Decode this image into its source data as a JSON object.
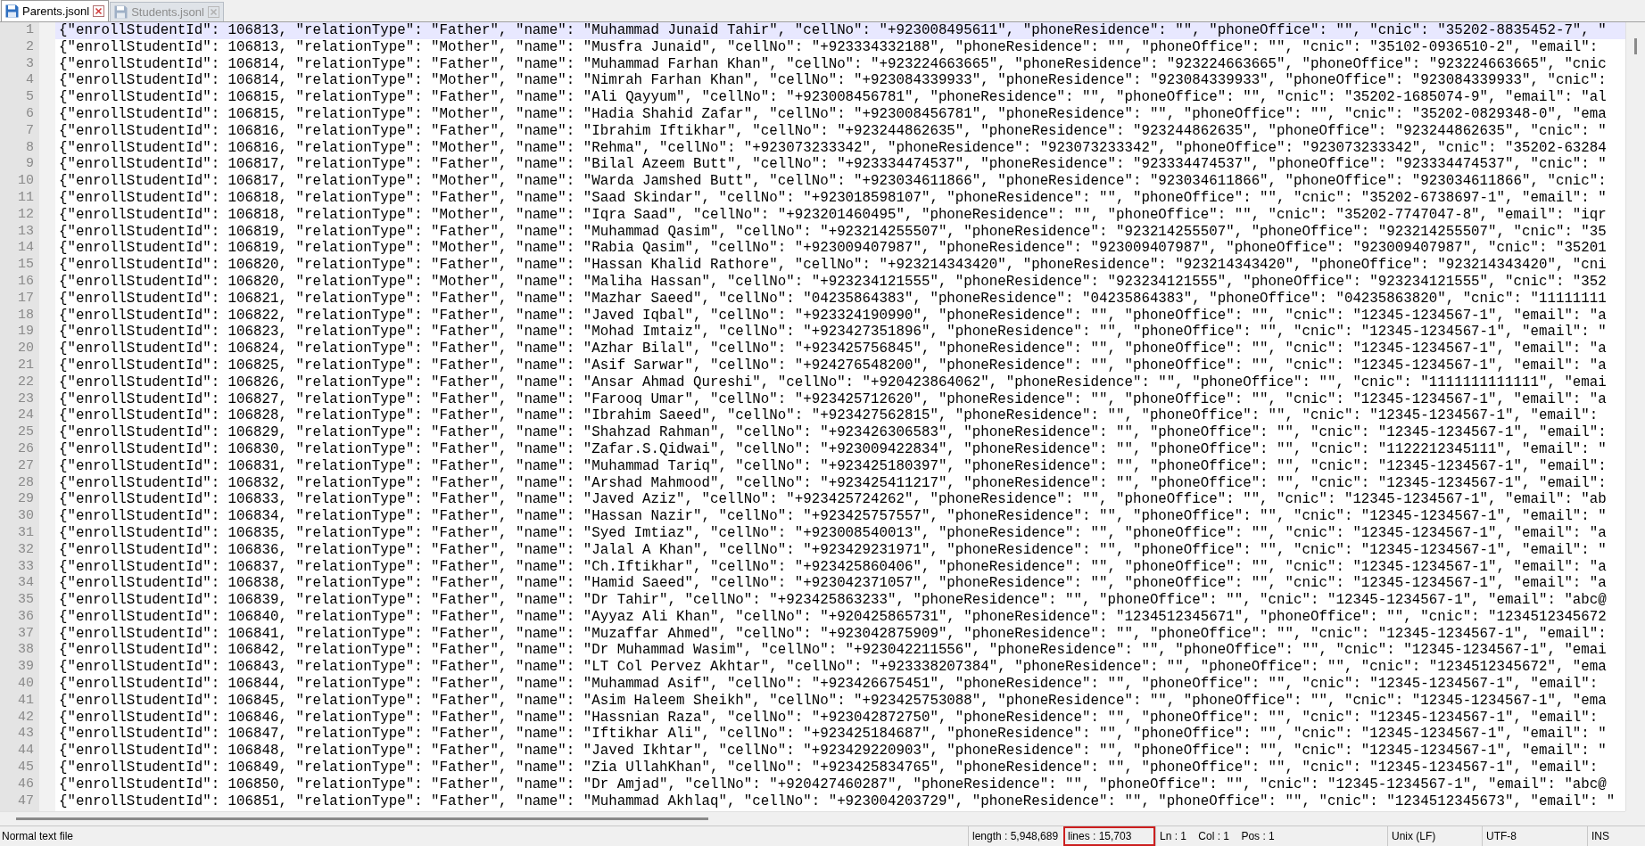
{
  "tabs": [
    {
      "label": "Parents.jsonl",
      "selected": true
    },
    {
      "label": "Students.jsonl",
      "selected": false
    }
  ],
  "editor": {
    "lines": [
      {
        "number": "1",
        "current": true,
        "text": "{\"enrollStudentId\": 106813, \"relationType\": \"Father\", \"name\": \"Muhammad Junaid Tahir\", \"cellNo\": \"+923008495611\", \"phoneResidence\": \"\", \"phoneOffice\": \"\", \"cnic\": \"35202-8835452-7\", \""
      },
      {
        "number": "2",
        "current": false,
        "text": "{\"enrollStudentId\": 106813, \"relationType\": \"Mother\", \"name\": \"Musfra Junaid\", \"cellNo\": \"+923334332188\", \"phoneResidence\": \"\", \"phoneOffice\": \"\", \"cnic\": \"35102-0936510-2\", \"email\":"
      },
      {
        "number": "3",
        "current": false,
        "text": "{\"enrollStudentId\": 106814, \"relationType\": \"Father\", \"name\": \"Muhammad Farhan Khan\", \"cellNo\": \"+923224663665\", \"phoneResidence\": \"923224663665\", \"phoneOffice\": \"923224663665\", \"cnic"
      },
      {
        "number": "4",
        "current": false,
        "text": "{\"enrollStudentId\": 106814, \"relationType\": \"Mother\", \"name\": \"Nimrah Farhan Khan\", \"cellNo\": \"+923084339933\", \"phoneResidence\": \"923084339933\", \"phoneOffice\": \"923084339933\", \"cnic\":"
      },
      {
        "number": "5",
        "current": false,
        "text": "{\"enrollStudentId\": 106815, \"relationType\": \"Father\", \"name\": \"Ali Qayyum\", \"cellNo\": \"+923008456781\", \"phoneResidence\": \"\", \"phoneOffice\": \"\", \"cnic\": \"35202-1685074-9\", \"email\": \"al"
      },
      {
        "number": "6",
        "current": false,
        "text": "{\"enrollStudentId\": 106815, \"relationType\": \"Mother\", \"name\": \"Hadia Shahid Zafar\", \"cellNo\": \"+923008456781\", \"phoneResidence\": \"\", \"phoneOffice\": \"\", \"cnic\": \"35202-0829348-0\", \"ema"
      },
      {
        "number": "7",
        "current": false,
        "text": "{\"enrollStudentId\": 106816, \"relationType\": \"Father\", \"name\": \"Ibrahim Iftikhar\", \"cellNo\": \"+923244862635\", \"phoneResidence\": \"923244862635\", \"phoneOffice\": \"923244862635\", \"cnic\": \""
      },
      {
        "number": "8",
        "current": false,
        "text": "{\"enrollStudentId\": 106816, \"relationType\": \"Mother\", \"name\": \"Rehma\", \"cellNo\": \"+923073233342\", \"phoneResidence\": \"923073233342\", \"phoneOffice\": \"923073233342\", \"cnic\": \"35202-63284"
      },
      {
        "number": "9",
        "current": false,
        "text": "{\"enrollStudentId\": 106817, \"relationType\": \"Father\", \"name\": \"Bilal Azeem Butt\", \"cellNo\": \"+923334474537\", \"phoneResidence\": \"923334474537\", \"phoneOffice\": \"923334474537\", \"cnic\": \""
      },
      {
        "number": "10",
        "current": false,
        "text": "{\"enrollStudentId\": 106817, \"relationType\": \"Mother\", \"name\": \"Warda Jamshed Butt\", \"cellNo\": \"+923034611866\", \"phoneResidence\": \"923034611866\", \"phoneOffice\": \"923034611866\", \"cnic\":"
      },
      {
        "number": "11",
        "current": false,
        "text": "{\"enrollStudentId\": 106818, \"relationType\": \"Father\", \"name\": \"Saad Skindar\", \"cellNo\": \"+923018598107\", \"phoneResidence\": \"\", \"phoneOffice\": \"\", \"cnic\": \"35202-6738697-1\", \"email\": \""
      },
      {
        "number": "12",
        "current": false,
        "text": "{\"enrollStudentId\": 106818, \"relationType\": \"Mother\", \"name\": \"Iqra Saad\", \"cellNo\": \"+923201460495\", \"phoneResidence\": \"\", \"phoneOffice\": \"\", \"cnic\": \"35202-7747047-8\", \"email\": \"iqr"
      },
      {
        "number": "13",
        "current": false,
        "text": "{\"enrollStudentId\": 106819, \"relationType\": \"Father\", \"name\": \"Muhammad Qasim\", \"cellNo\": \"+923214255507\", \"phoneResidence\": \"923214255507\", \"phoneOffice\": \"923214255507\", \"cnic\": \"35"
      },
      {
        "number": "14",
        "current": false,
        "text": "{\"enrollStudentId\": 106819, \"relationType\": \"Mother\", \"name\": \"Rabia Qasim\", \"cellNo\": \"+923009407987\", \"phoneResidence\": \"923009407987\", \"phoneOffice\": \"923009407987\", \"cnic\": \"35201"
      },
      {
        "number": "15",
        "current": false,
        "text": "{\"enrollStudentId\": 106820, \"relationType\": \"Father\", \"name\": \"Hassan Khalid Rathore\", \"cellNo\": \"+923214343420\", \"phoneResidence\": \"923214343420\", \"phoneOffice\": \"923214343420\", \"cni"
      },
      {
        "number": "16",
        "current": false,
        "text": "{\"enrollStudentId\": 106820, \"relationType\": \"Mother\", \"name\": \"Maliha Hassan\", \"cellNo\": \"+923234121555\", \"phoneResidence\": \"923234121555\", \"phoneOffice\": \"923234121555\", \"cnic\": \"352"
      },
      {
        "number": "17",
        "current": false,
        "text": "{\"enrollStudentId\": 106821, \"relationType\": \"Father\", \"name\": \"Mazhar Saeed\", \"cellNo\": \"04235864383\", \"phoneResidence\": \"04235864383\", \"phoneOffice\": \"04235863820\", \"cnic\": \"11111111"
      },
      {
        "number": "18",
        "current": false,
        "text": "{\"enrollStudentId\": 106822, \"relationType\": \"Father\", \"name\": \"Javed Iqbal\", \"cellNo\": \"+923324190990\", \"phoneResidence\": \"\", \"phoneOffice\": \"\", \"cnic\": \"12345-1234567-1\", \"email\": \"a"
      },
      {
        "number": "19",
        "current": false,
        "text": "{\"enrollStudentId\": 106823, \"relationType\": \"Father\", \"name\": \"Mohad Imtaiz\", \"cellNo\": \"+923427351896\", \"phoneResidence\": \"\", \"phoneOffice\": \"\", \"cnic\": \"12345-1234567-1\", \"email\": \""
      },
      {
        "number": "20",
        "current": false,
        "text": "{\"enrollStudentId\": 106824, \"relationType\": \"Father\", \"name\": \"Azhar Bilal\", \"cellNo\": \"+923425756845\", \"phoneResidence\": \"\", \"phoneOffice\": \"\", \"cnic\": \"12345-1234567-1\", \"email\": \"a"
      },
      {
        "number": "21",
        "current": false,
        "text": "{\"enrollStudentId\": 106825, \"relationType\": \"Father\", \"name\": \"Asif Sarwar\", \"cellNo\": \"+924276548200\", \"phoneResidence\": \"\", \"phoneOffice\": \"\", \"cnic\": \"12345-1234567-1\", \"email\": \"a"
      },
      {
        "number": "22",
        "current": false,
        "text": "{\"enrollStudentId\": 106826, \"relationType\": \"Father\", \"name\": \"Ansar Ahmad Qureshi\", \"cellNo\": \"+920423864062\", \"phoneResidence\": \"\", \"phoneOffice\": \"\", \"cnic\": \"1111111111111\", \"emai"
      },
      {
        "number": "23",
        "current": false,
        "text": "{\"enrollStudentId\": 106827, \"relationType\": \"Father\", \"name\": \"Farooq Umar\", \"cellNo\": \"+923425712620\", \"phoneResidence\": \"\", \"phoneOffice\": \"\", \"cnic\": \"12345-1234567-1\", \"email\": \"a"
      },
      {
        "number": "24",
        "current": false,
        "text": "{\"enrollStudentId\": 106828, \"relationType\": \"Father\", \"name\": \"Ibrahim Saeed\", \"cellNo\": \"+923427562815\", \"phoneResidence\": \"\", \"phoneOffice\": \"\", \"cnic\": \"12345-1234567-1\", \"email\":"
      },
      {
        "number": "25",
        "current": false,
        "text": "{\"enrollStudentId\": 106829, \"relationType\": \"Father\", \"name\": \"Shahzad Rahman\", \"cellNo\": \"+923426306583\", \"phoneResidence\": \"\", \"phoneOffice\": \"\", \"cnic\": \"12345-1234567-1\", \"email\":"
      },
      {
        "number": "26",
        "current": false,
        "text": "{\"enrollStudentId\": 106830, \"relationType\": \"Father\", \"name\": \"Zafar.S.Qidwai\", \"cellNo\": \"+923009422834\", \"phoneResidence\": \"\", \"phoneOffice\": \"\", \"cnic\": \"1122212345111\", \"email\": \""
      },
      {
        "number": "27",
        "current": false,
        "text": "{\"enrollStudentId\": 106831, \"relationType\": \"Father\", \"name\": \"Muhammad Tariq\", \"cellNo\": \"+923425180397\", \"phoneResidence\": \"\", \"phoneOffice\": \"\", \"cnic\": \"12345-1234567-1\", \"email\":"
      },
      {
        "number": "28",
        "current": false,
        "text": "{\"enrollStudentId\": 106832, \"relationType\": \"Father\", \"name\": \"Arshad Mahmood\", \"cellNo\": \"+923425411217\", \"phoneResidence\": \"\", \"phoneOffice\": \"\", \"cnic\": \"12345-1234567-1\", \"email\":"
      },
      {
        "number": "29",
        "current": false,
        "text": "{\"enrollStudentId\": 106833, \"relationType\": \"Father\", \"name\": \"Javed Aziz\", \"cellNo\": \"+923425724262\", \"phoneResidence\": \"\", \"phoneOffice\": \"\", \"cnic\": \"12345-1234567-1\", \"email\": \"ab"
      },
      {
        "number": "30",
        "current": false,
        "text": "{\"enrollStudentId\": 106834, \"relationType\": \"Father\", \"name\": \"Hassan Nazir\", \"cellNo\": \"+923425757557\", \"phoneResidence\": \"\", \"phoneOffice\": \"\", \"cnic\": \"12345-1234567-1\", \"email\": \""
      },
      {
        "number": "31",
        "current": false,
        "text": "{\"enrollStudentId\": 106835, \"relationType\": \"Father\", \"name\": \"Syed Imtiaz\", \"cellNo\": \"+923008540013\", \"phoneResidence\": \"\", \"phoneOffice\": \"\", \"cnic\": \"12345-1234567-1\", \"email\": \"a"
      },
      {
        "number": "32",
        "current": false,
        "text": "{\"enrollStudentId\": 106836, \"relationType\": \"Father\", \"name\": \"Jalal A Khan\", \"cellNo\": \"+923429231971\", \"phoneResidence\": \"\", \"phoneOffice\": \"\", \"cnic\": \"12345-1234567-1\", \"email\": \""
      },
      {
        "number": "33",
        "current": false,
        "text": "{\"enrollStudentId\": 106837, \"relationType\": \"Father\", \"name\": \"Ch.Iftikhar\", \"cellNo\": \"+923425860406\", \"phoneResidence\": \"\", \"phoneOffice\": \"\", \"cnic\": \"12345-1234567-1\", \"email\": \"a"
      },
      {
        "number": "34",
        "current": false,
        "text": "{\"enrollStudentId\": 106838, \"relationType\": \"Father\", \"name\": \"Hamid Saeed\", \"cellNo\": \"+923042371057\", \"phoneResidence\": \"\", \"phoneOffice\": \"\", \"cnic\": \"12345-1234567-1\", \"email\": \"a"
      },
      {
        "number": "35",
        "current": false,
        "text": "{\"enrollStudentId\": 106839, \"relationType\": \"Father\", \"name\": \"Dr Tahir\", \"cellNo\": \"+923425863233\", \"phoneResidence\": \"\", \"phoneOffice\": \"\", \"cnic\": \"12345-1234567-1\", \"email\": \"abc@"
      },
      {
        "number": "36",
        "current": false,
        "text": "{\"enrollStudentId\": 106840, \"relationType\": \"Father\", \"name\": \"Ayyaz Ali Khan\", \"cellNo\": \"+920425865731\", \"phoneResidence\": \"1234512345671\", \"phoneOffice\": \"\", \"cnic\": \"1234512345672"
      },
      {
        "number": "37",
        "current": false,
        "text": "{\"enrollStudentId\": 106841, \"relationType\": \"Father\", \"name\": \"Muzaffar Ahmed\", \"cellNo\": \"+923042875909\", \"phoneResidence\": \"\", \"phoneOffice\": \"\", \"cnic\": \"12345-1234567-1\", \"email\":"
      },
      {
        "number": "38",
        "current": false,
        "text": "{\"enrollStudentId\": 106842, \"relationType\": \"Father\", \"name\": \"Dr Muhammad Wasim\", \"cellNo\": \"+923042211556\", \"phoneResidence\": \"\", \"phoneOffice\": \"\", \"cnic\": \"12345-1234567-1\", \"emai"
      },
      {
        "number": "39",
        "current": false,
        "text": "{\"enrollStudentId\": 106843, \"relationType\": \"Father\", \"name\": \"LT Col Pervez Akhtar\", \"cellNo\": \"+923338207384\", \"phoneResidence\": \"\", \"phoneOffice\": \"\", \"cnic\": \"1234512345672\", \"ema"
      },
      {
        "number": "40",
        "current": false,
        "text": "{\"enrollStudentId\": 106844, \"relationType\": \"Father\", \"name\": \"Muhammad Asif\", \"cellNo\": \"+923426675451\", \"phoneResidence\": \"\", \"phoneOffice\": \"\", \"cnic\": \"12345-1234567-1\", \"email\":"
      },
      {
        "number": "41",
        "current": false,
        "text": "{\"enrollStudentId\": 106845, \"relationType\": \"Father\", \"name\": \"Asim Haleem Sheikh\", \"cellNo\": \"+923425753088\", \"phoneResidence\": \"\", \"phoneOffice\": \"\", \"cnic\": \"12345-1234567-1\", \"ema"
      },
      {
        "number": "42",
        "current": false,
        "text": "{\"enrollStudentId\": 106846, \"relationType\": \"Father\", \"name\": \"Hassnian Raza\", \"cellNo\": \"+923042872750\", \"phoneResidence\": \"\", \"phoneOffice\": \"\", \"cnic\": \"12345-1234567-1\", \"email\":"
      },
      {
        "number": "43",
        "current": false,
        "text": "{\"enrollStudentId\": 106847, \"relationType\": \"Father\", \"name\": \"Iftikhar Ali\", \"cellNo\": \"+923425184687\", \"phoneResidence\": \"\", \"phoneOffice\": \"\", \"cnic\": \"12345-1234567-1\", \"email\": \""
      },
      {
        "number": "44",
        "current": false,
        "text": "{\"enrollStudentId\": 106848, \"relationType\": \"Father\", \"name\": \"Javed Ikhtar\", \"cellNo\": \"+923429220903\", \"phoneResidence\": \"\", \"phoneOffice\": \"\", \"cnic\": \"12345-1234567-1\", \"email\": \""
      },
      {
        "number": "45",
        "current": false,
        "text": "{\"enrollStudentId\": 106849, \"relationType\": \"Father\", \"name\": \"Zia UllahKhan\", \"cellNo\": \"+923425834765\", \"phoneResidence\": \"\", \"phoneOffice\": \"\", \"cnic\": \"12345-1234567-1\", \"email\":"
      },
      {
        "number": "46",
        "current": false,
        "text": "{\"enrollStudentId\": 106850, \"relationType\": \"Father\", \"name\": \"Dr Amjad\", \"cellNo\": \"+920427460287\", \"phoneResidence\": \"\", \"phoneOffice\": \"\", \"cnic\": \"12345-1234567-1\", \"email\": \"abc@"
      },
      {
        "number": "47",
        "current": false,
        "text": "{\"enrollStudentId\": 106851, \"relationType\": \"Father\", \"name\": \"Muhammad Akhlaq\", \"cellNo\": \"+923004203729\", \"phoneResidence\": \"\", \"phoneOffice\": \"\", \"cnic\": \"1234512345673\", \"email\": \""
      }
    ]
  },
  "status_bar": {
    "file_type": "Normal text file",
    "fields": [
      {
        "text": "length : 5,948,689",
        "highlighted": false
      },
      {
        "text": "lines : 15,703",
        "highlighted": true
      },
      {
        "text": "Ln : 1    Col : 1    Pos : 1",
        "highlighted": false
      },
      {
        "text": "Unix (LF)",
        "highlighted": false
      },
      {
        "text": "UTF-8",
        "highlighted": false
      },
      {
        "text": "INS",
        "highlighted": false
      }
    ]
  }
}
